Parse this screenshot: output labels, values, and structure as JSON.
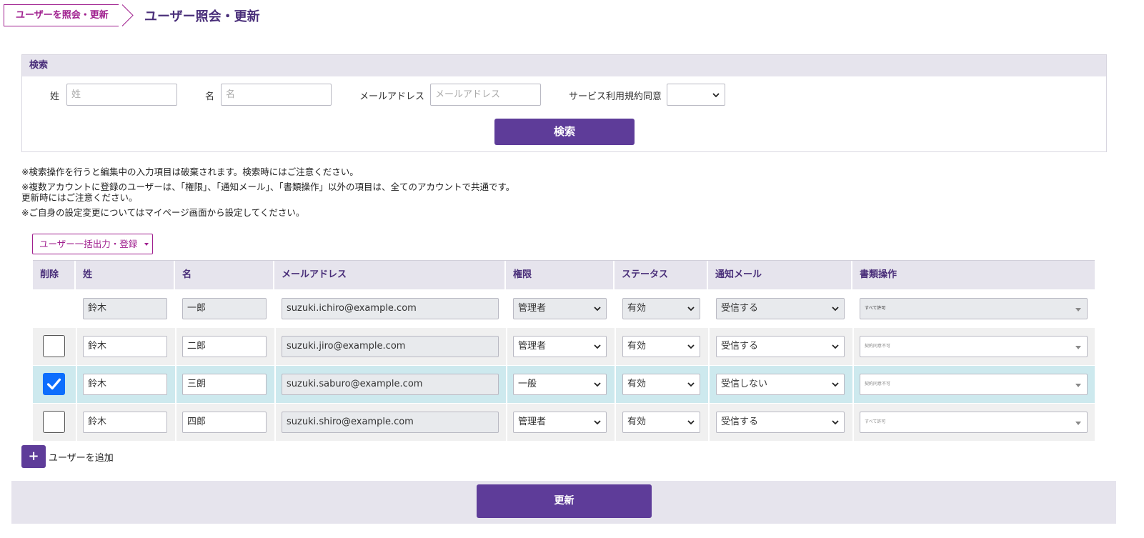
{
  "breadcrumb": {
    "label": "ユーザーを照会・更新"
  },
  "page_title": "ユーザー照会・更新",
  "search": {
    "header": "検索",
    "last_name_label": "姓",
    "last_name_placeholder": "姓",
    "first_name_label": "名",
    "first_name_placeholder": "名",
    "email_label": "メールアドレス",
    "email_placeholder": "メールアドレス",
    "terms_label": "サービス利用規約同意",
    "terms_value": "",
    "button": "検索"
  },
  "notes": {
    "line1": "※検索操作を行うと編集中の入力項目は破棄されます。検索時にはご注意ください。",
    "line2": "※複数アカウントに登録のユーザーは、「権限」、「通知メール」、「書類操作」以外の項目は、全てのアカウントで共通です。",
    "line3": "更新時にはご注意ください。",
    "line4": "※ご自身の設定変更についてはマイページ画面から設定してください。"
  },
  "bulk_button": "ユーザー一括出力・登録",
  "table": {
    "headers": {
      "delete": "削除",
      "last_name": "姓",
      "first_name": "名",
      "email": "メールアドレス",
      "role": "権限",
      "status": "ステータス",
      "notify": "通知メール",
      "docs": "書類操作"
    },
    "rows": [
      {
        "checkbox": "none",
        "last": "鈴木",
        "first": "一郎",
        "email": "suzuki.ichiro@example.com",
        "role": "管理者",
        "status": "有効",
        "notify": "受信する",
        "docs": "すべて許可"
      },
      {
        "checkbox": "unchecked",
        "last": "鈴木",
        "first": "二郎",
        "email": "suzuki.jiro@example.com",
        "role": "管理者",
        "status": "有効",
        "notify": "受信する",
        "docs": "契約同意不可"
      },
      {
        "checkbox": "checked",
        "last": "鈴木",
        "first": "三朗",
        "email": "suzuki.saburo@example.com",
        "role": "一般",
        "status": "有効",
        "notify": "受信しない",
        "docs": "契約同意不可"
      },
      {
        "checkbox": "unchecked",
        "last": "鈴木",
        "first": "四郎",
        "email": "suzuki.shiro@example.com",
        "role": "管理者",
        "status": "有効",
        "notify": "受信する",
        "docs": "すべて許可"
      }
    ]
  },
  "add_user": {
    "icon": "+",
    "label": "ユーザーを追加"
  },
  "update_button": "更新",
  "colors": {
    "primary": "#5e3c99",
    "accent": "#a0208f",
    "header_bg": "#e6e4ed",
    "selected_row": "#cde9ee"
  }
}
